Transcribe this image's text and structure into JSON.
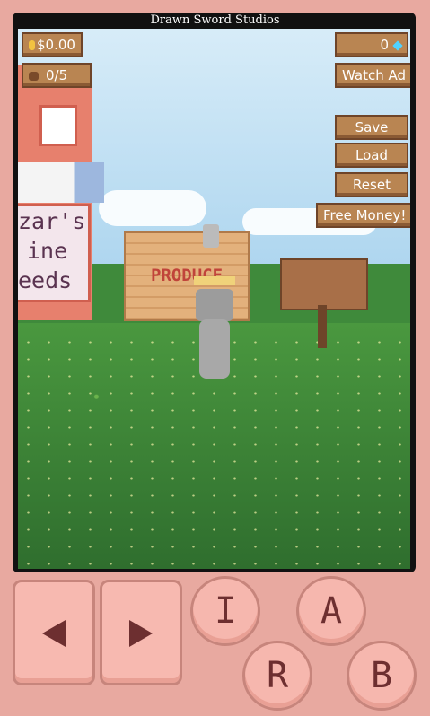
{
  "header": {
    "studio": "Drawn Sword Studios"
  },
  "hud": {
    "money": "$0.00",
    "inventory": "0/5",
    "gems": "0",
    "watch_ad": "Watch Ad",
    "save": "Save",
    "load": "Load",
    "reset": "Reset",
    "free_money": "Free Money!"
  },
  "scene": {
    "shop_sign_lines": [
      "zar's",
      "ine",
      "eeds"
    ],
    "stand_label": "PRODUCE"
  },
  "controls": {
    "left": "◀",
    "right": "▶",
    "i": "I",
    "a": "A",
    "r": "R",
    "b": "B"
  },
  "colors": {
    "background": "#e8a9a0",
    "button": "#f6b7ae",
    "wood": "#b98552"
  }
}
